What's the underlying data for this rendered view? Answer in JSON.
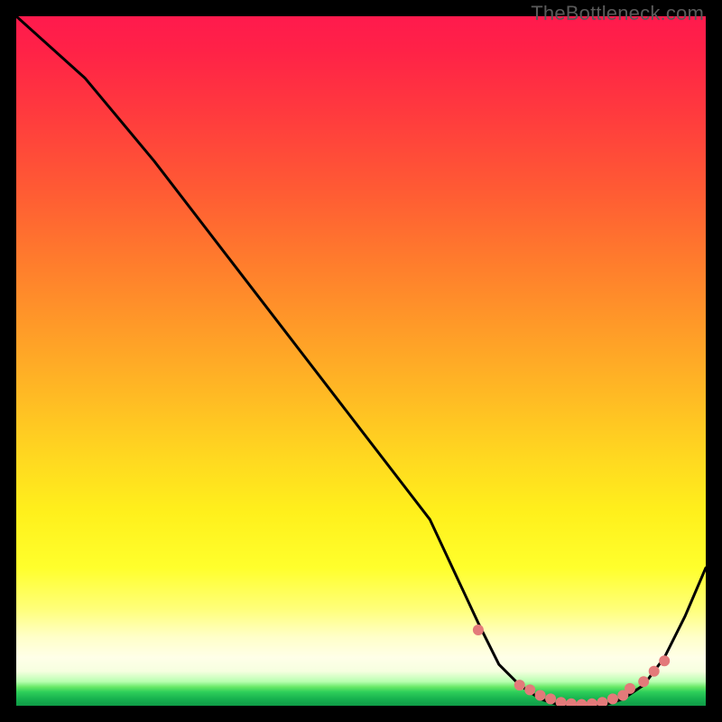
{
  "watermark": "TheBottleneck.com",
  "chart_data": {
    "type": "line",
    "title": "",
    "xlabel": "",
    "ylabel": "",
    "xlim": [
      0,
      100
    ],
    "ylim": [
      0,
      100
    ],
    "grid": false,
    "series": [
      {
        "name": "bottleneck-curve",
        "color": "#000000",
        "x": [
          0,
          10,
          20,
          30,
          40,
          50,
          60,
          67,
          70,
          73,
          76,
          79,
          82,
          85,
          88,
          91,
          94,
          97,
          100
        ],
        "values": [
          100,
          91,
          79,
          66,
          53,
          40,
          27,
          12,
          6,
          3,
          1,
          0,
          0,
          0,
          1,
          3,
          7,
          13,
          20
        ]
      }
    ],
    "markers": {
      "name": "highlight-dots",
      "color": "#e37a7a",
      "radius": 6,
      "x": [
        67,
        73,
        74.5,
        76,
        77.5,
        79,
        80.5,
        82,
        83.5,
        85,
        86.5,
        88,
        89,
        91,
        92.5,
        94
      ],
      "values": [
        11,
        3,
        2.3,
        1.5,
        1.0,
        0.5,
        0.3,
        0.2,
        0.3,
        0.5,
        1.0,
        1.5,
        2.5,
        3.5,
        5.0,
        6.5
      ]
    }
  }
}
